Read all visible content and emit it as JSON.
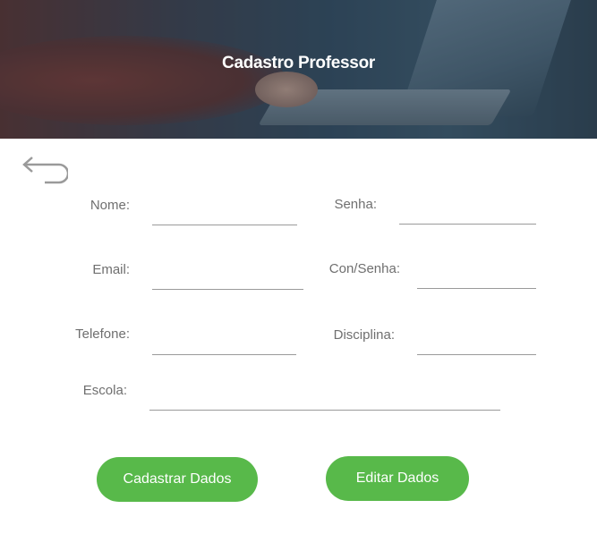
{
  "header": {
    "title": "Cadastro Professor"
  },
  "nav": {
    "back_icon": "undo-arrow-icon"
  },
  "form": {
    "nome_label": "Nome:",
    "nome_value": "",
    "senha_label": "Senha:",
    "senha_value": "",
    "email_label": "Email:",
    "email_value": "",
    "consenha_label": "Con/Senha:",
    "consenha_value": "",
    "telefone_label": "Telefone:",
    "telefone_value": "",
    "disciplina_label": "Disciplina:",
    "disciplina_value": "",
    "escola_label": "Escola:",
    "escola_value": ""
  },
  "actions": {
    "cadastrar_label": "Cadastrar Dados",
    "editar_label": "Editar Dados"
  },
  "colors": {
    "button_green": "#58b94a",
    "label_gray": "#6f6f6f"
  }
}
